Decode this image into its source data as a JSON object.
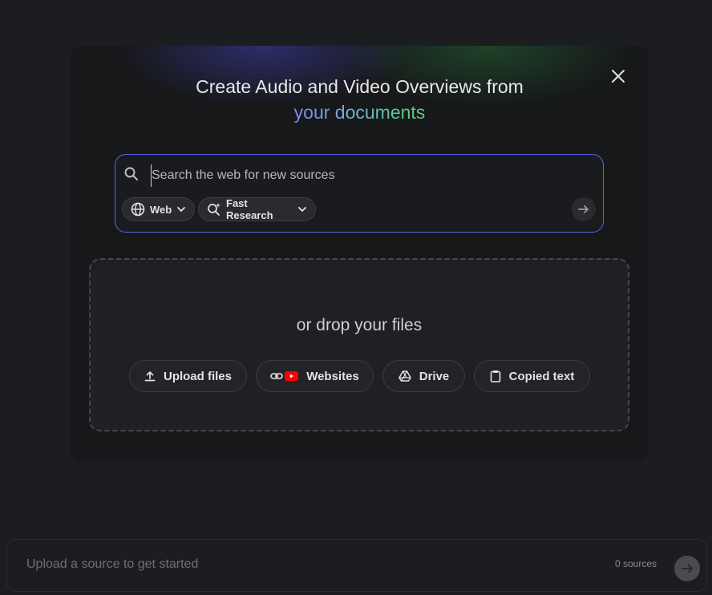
{
  "modal": {
    "title_line1": "Create Audio and Video Overviews from",
    "title_line2": "your documents",
    "close_icon": "close-icon"
  },
  "search": {
    "placeholder": "Search the web for new sources",
    "value": "",
    "chips": {
      "web_label": "Web",
      "research_label": "Fast Research"
    }
  },
  "dropzone": {
    "text": "or drop your files",
    "buttons": {
      "upload": "Upload files",
      "websites": "Websites",
      "drive": "Drive",
      "copied": "Copied text"
    }
  },
  "bottom": {
    "placeholder": "Upload a source to get started",
    "sources_count": "0 sources"
  },
  "colors": {
    "accent_border": "#5a67e8",
    "youtube_red": "#ff0000"
  }
}
